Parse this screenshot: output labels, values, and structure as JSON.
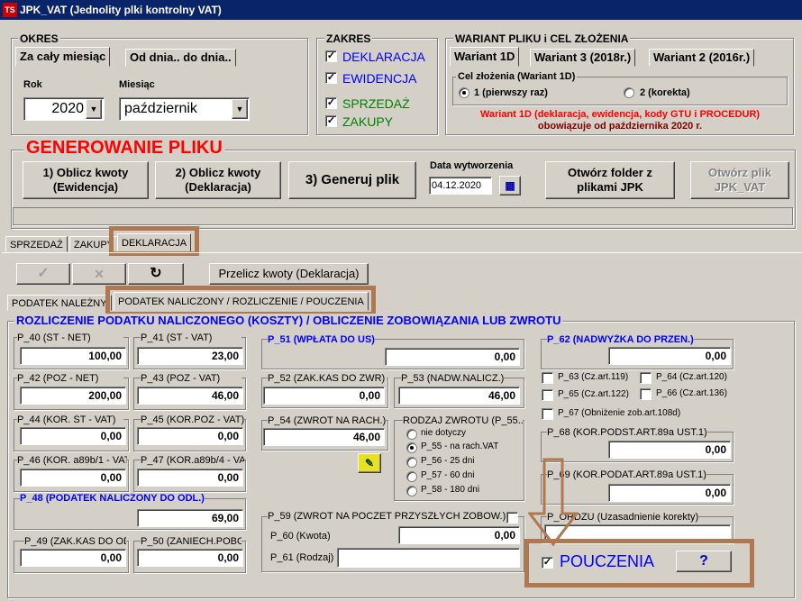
{
  "window": {
    "title": "JPK_VAT (Jednolity plki kontrolny VAT)",
    "icon": "TS"
  },
  "okres": {
    "title": "OKRES",
    "tab1": "Za cały miesiąc",
    "tab2": "Od dnia.. do dnia..",
    "rok_label": "Rok",
    "rok": "2020",
    "miesiac_label": "Miesiąc",
    "miesiac": "październik"
  },
  "zakres": {
    "title": "ZAKRES",
    "deklaracja": "DEKLARACJA",
    "ewidencje": "EWIDENCJA",
    "sprzedaz": "SPRZEDAŻ",
    "zakupy": "ZAKUPY"
  },
  "wariant": {
    "title": "WARIANT PLIKU i CEL ZŁOŻENIA",
    "tab1": "Wariant 1D",
    "tab2": "Wariant 3 (2018r.)",
    "tab3": "Wariant 2  (2016r.)",
    "cel_title": "Cel złożenia (Wariant 1D)",
    "opt1": "1 (pierwszy raz)",
    "opt2": "2 (korekta)",
    "note1": "Wariant 1D (deklaracja, ewidencja, kody GTU i PROCEDUR)",
    "note2": "obowiązuje od października 2020 r."
  },
  "generowanie": {
    "title": "GENEROWANIE PLIKU",
    "btn1": "1) Oblicz kwoty\n(Ewidencja)",
    "btn2": "2) Oblicz kwoty\n(Deklaracja)",
    "btn3": "3) Generuj plik",
    "data_label": "Data wytworzenia",
    "data": "04.12.2020",
    "btn_folder": "Otwórz folder z\nplikami JPK",
    "btn_plik": "Otwórz plik\nJPK_VAT"
  },
  "tabs": {
    "sprzedaz": "SPRZEDAŻ",
    "zakupy": "ZAKUPY",
    "deklaracja": "DEKLARACJA"
  },
  "toolbar": {
    "check": "✓",
    "cross": "✕",
    "refresh": "↻",
    "przelicz": "Przelicz kwoty (Deklaracja)"
  },
  "subtabs": {
    "nalezny": "PODATEK NALEŻNY",
    "naliczony": "PODATEK NALICZONY / ROZLICZENIE / POUCZENIA"
  },
  "section_title": "ROZLICZENIE PODATKU NALICZONEGO (KOSZTY) / OBLICZENIE ZOBOWIĄZANIA LUB ZWROTU",
  "fields": {
    "p40": {
      "label": "P_40 (ŚT - NET)",
      "value": "100,00"
    },
    "p41": {
      "label": "P_41 (ŚT - VAT)",
      "value": "23,00"
    },
    "p42": {
      "label": "P_42 (POZ - NET)",
      "value": "200,00"
    },
    "p43": {
      "label": "P_43 (POZ - VAT)",
      "value": "46,00"
    },
    "p44": {
      "label": "P_44 (KOR. ŚT - VAT)",
      "value": "0,00"
    },
    "p45": {
      "label": "P_45 (KOR.POZ - VAT)",
      "value": "0,00"
    },
    "p46": {
      "label": "P_46 (KOR. a89b/1 - VAT)",
      "value": "0,00"
    },
    "p47": {
      "label": "P_47 (KOR.a89b/4 - VAT)",
      "value": "0,00"
    },
    "p48": {
      "label": "P_48 (PODATEK NALICZONY DO ODL.)",
      "value": "69,00"
    },
    "p49": {
      "label": "P_49 (ZAK.KAS DO ODL.)",
      "value": "0,00"
    },
    "p50": {
      "label": "P_50 (ZANIECH.POBOR.)",
      "value": "0,00"
    },
    "p51": {
      "label": "P_51 (WPŁATA DO US)",
      "value": "0,00"
    },
    "p52": {
      "label": "P_52 (ZAK.KAS DO ZWR)",
      "value": "0,00"
    },
    "p53": {
      "label": "P_53 (NADW.NALICZ.)",
      "value": "46,00"
    },
    "p54": {
      "label": "P_54 (ZWROT NA RACH.)",
      "value": "46,00"
    },
    "p59": {
      "label": "P_59 (ZWROT NA POCZET PRZYSZŁYCH ZOBOW.)"
    },
    "p60": {
      "label": "P_60 (Kwota)",
      "value": "0,00"
    },
    "p61": {
      "label": "P_61 (Rodzaj)",
      "value": ""
    },
    "p62": {
      "label": "P_62 (NADWYŻKA DO PRZEN.)",
      "value": "0,00"
    },
    "p68": {
      "label": "P_68 (KOR.PODST.ART.89a UST.1)",
      "value": "0,00"
    },
    "p69": {
      "label": "P_69 (KOR.PODAT.ART.89a UST.1)",
      "value": "0,00"
    },
    "ordzu": {
      "label": "P_ORDZU (Uzasadnienie korekty)",
      "value": ""
    }
  },
  "rodzaj": {
    "title": "RODZAJ ZWROTU (P_55...)",
    "o1": "nie dotyczy",
    "o2": "P_55 - na rach.VAT",
    "o3": "P_56 - 25 dni",
    "o4": "P_57 - 60 dni",
    "o5": "P_58 - 180 dni"
  },
  "checks": {
    "p63": "P_63 (Cz.art.119)",
    "p64": "P_64 (Cz.art.120)",
    "p65": "P_65 (Cz.art.122)",
    "p66": "P_66 (Cz.art.136)",
    "p67": "P_67 (Obniżenie zob.art.108d)"
  },
  "pouczenia": {
    "label": "POUCZENIA",
    "help": "?"
  },
  "colors": {
    "titlebar": "#0a246a",
    "highlight": "#b07850",
    "blue": "#0000ff",
    "red": "#ff0000",
    "green": "#008000"
  }
}
